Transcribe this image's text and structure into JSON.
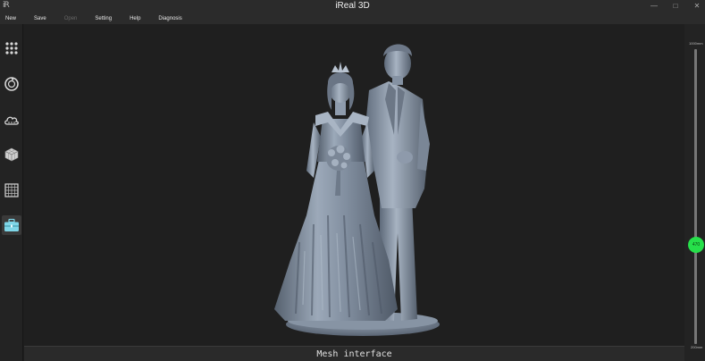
{
  "window": {
    "logo_text": "iR",
    "title": "iReal 3D",
    "controls": {
      "minimize": "—",
      "maximize": "□",
      "close": "✕"
    }
  },
  "menu": [
    {
      "label": "New",
      "enabled": true
    },
    {
      "label": "Save",
      "enabled": true
    },
    {
      "label": "Open",
      "enabled": false
    },
    {
      "label": "Setting",
      "enabled": true
    },
    {
      "label": "Help",
      "enabled": true
    },
    {
      "label": "Diagnosis",
      "enabled": true
    }
  ],
  "sidebar": {
    "items": [
      {
        "icon": "grid-dots-icon",
        "active": false
      },
      {
        "icon": "scan-rotate-icon",
        "active": false
      },
      {
        "icon": "cloud-icon",
        "active": false
      },
      {
        "icon": "mesh-cube-icon",
        "active": false
      },
      {
        "icon": "texture-grid-icon",
        "active": false
      },
      {
        "icon": "toolbox-icon",
        "active": true
      }
    ],
    "active_color": "#7fd6e8"
  },
  "status": {
    "text": "Mesh interface"
  },
  "distance_slider": {
    "max_label": "1000mm",
    "min_label": "200mm",
    "value_label": "470",
    "value": 470,
    "min": 200,
    "max": 1000,
    "knob_color": "#26e04a"
  },
  "colors": {
    "model": "#8a97a8",
    "background": "#1f1f1f"
  }
}
